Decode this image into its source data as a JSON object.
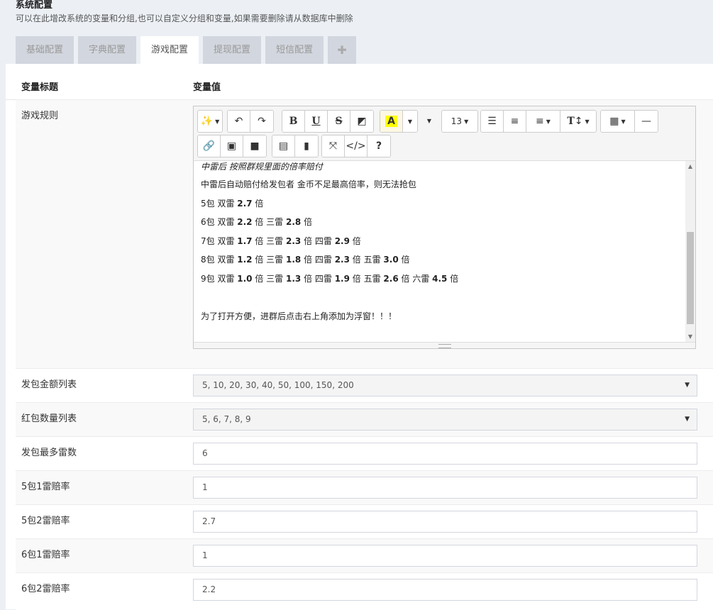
{
  "header": {
    "title": "系统配置",
    "description": "可以在此增改系统的变量和分组,也可以自定义分组和变量,如果需要删除请从数据库中删除"
  },
  "tabs": [
    {
      "label": "基础配置",
      "active": false
    },
    {
      "label": "字典配置",
      "active": false
    },
    {
      "label": "游戏配置",
      "active": true
    },
    {
      "label": "提现配置",
      "active": false
    },
    {
      "label": "短信配置",
      "active": false
    }
  ],
  "add_tab_icon": "plus-icon",
  "table": {
    "col_title": "变量标题",
    "col_value": "变量值"
  },
  "game_rules": {
    "label": "游戏规则",
    "toolbar": {
      "font_size": "13",
      "icons": [
        "magic-wand-icon",
        "undo-icon",
        "redo-icon",
        "bold-icon",
        "underline-icon",
        "strikethrough-icon",
        "eraser-icon",
        "highlight-color-icon",
        "caret-down-icon",
        "caret-down-icon",
        "font-size-dropdown",
        "unordered-list-icon",
        "ordered-list-icon",
        "align-icon",
        "text-height-icon",
        "table-icon",
        "horizontal-rule-icon",
        "link-icon",
        "image-icon",
        "video-icon",
        "document-icon",
        "file-icon",
        "fullscreen-icon",
        "code-view-icon",
        "help-icon"
      ]
    },
    "content": [
      "中雷后 按照群规里面的倍率赔付",
      "中雷后自动赔付给发包者 金币不足最高倍率，则无法抢包",
      "5包 双雷 2.7 倍",
      "6包 双雷 2.2 倍 三雷 2.8 倍",
      "7包 双雷 1.7 倍 三雷 2.3 倍 四雷 2.9 倍",
      "8包 双雷 1.2 倍 三雷 1.8 倍 四雷 2.3 倍 五雷 3.0 倍",
      "9包 双雷 1.0 倍 三雷 1.3 倍 四雷 1.9 倍 五雷 2.6 倍 六雷 4.5 倍",
      "",
      "为了打开方便，进群后点击右上角添加为浮窗！！！"
    ]
  },
  "fields": [
    {
      "label": "发包金额列表",
      "value": "5, 10, 20, 30, 40, 50, 100, 150, 200",
      "type": "select"
    },
    {
      "label": "红包数量列表",
      "value": "5, 6, 7, 8, 9",
      "type": "select"
    },
    {
      "label": "发包最多雷数",
      "value": "6",
      "type": "input"
    },
    {
      "label": "5包1雷赔率",
      "value": "1",
      "type": "input"
    },
    {
      "label": "5包2雷赔率",
      "value": "2.7",
      "type": "input"
    },
    {
      "label": "6包1雷赔率",
      "value": "1",
      "type": "input"
    },
    {
      "label": "6包2雷赔率",
      "value": "2.2",
      "type": "input"
    }
  ]
}
